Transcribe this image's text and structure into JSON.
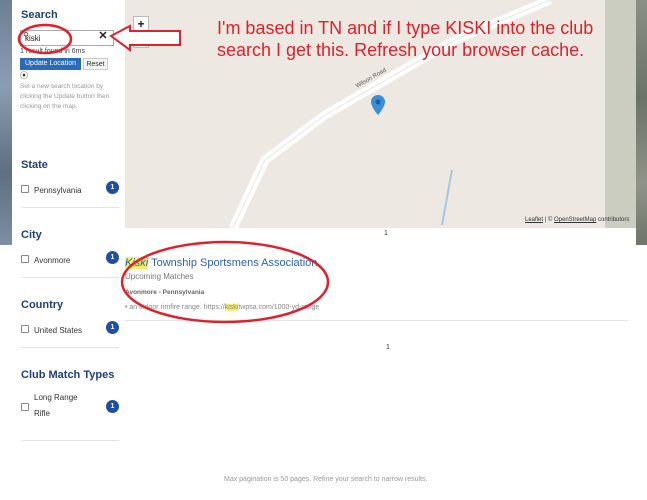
{
  "annotation": {
    "text": "I'm based in TN and if I type KISKI into the club search I get this. Refresh your browser cache."
  },
  "sidebar": {
    "search": {
      "heading": "Search",
      "value": "kiski",
      "results_count": "1 result found in 6ms",
      "update_label": "Update Location",
      "reset_label": "Reset",
      "location_help": "Set a new search location by clicking the Update button then clicking on the map."
    },
    "facets": [
      {
        "heading": "State",
        "items": [
          {
            "label": "Pennsylvania",
            "count": "1"
          }
        ]
      },
      {
        "heading": "City",
        "items": [
          {
            "label": "Avonmore",
            "count": "1"
          }
        ]
      },
      {
        "heading": "Country",
        "items": [
          {
            "label": "United States",
            "count": "1"
          }
        ]
      },
      {
        "heading": "Club Match Types",
        "items": [
          {
            "label_line1": "Long Range",
            "label_line2": "Rifle",
            "count": "1"
          }
        ]
      }
    ]
  },
  "map": {
    "zoom_in": "+",
    "zoom_out": "−",
    "road_label": "Wilson Road",
    "attribution_leaflet": "Leaflet",
    "attribution_sep": " | © ",
    "attribution_osm": "OpenStreetMap",
    "attribution_tail": " contributors"
  },
  "results": {
    "page_top": "1",
    "page_bottom": "1",
    "item": {
      "title_highlight": "Kiski",
      "title_rest": " Township Sportsmens Association",
      "subtitle": "Upcoming Matches",
      "location": "Avonmore - Pennsylvania",
      "desc_before": "• an indoor rimfire range. https://",
      "desc_highlight": "kiski",
      "desc_after": "twpsa.com/1000-yd-range"
    },
    "footer_note": "Max pagination is 50 pages. Refine your search to narrow results."
  },
  "colors": {
    "annotation": "#e0202a",
    "heading": "#1f3f7a",
    "badge": "#1f4ea3",
    "link": "#2a62b5",
    "highlight": "#f5ef6c"
  }
}
